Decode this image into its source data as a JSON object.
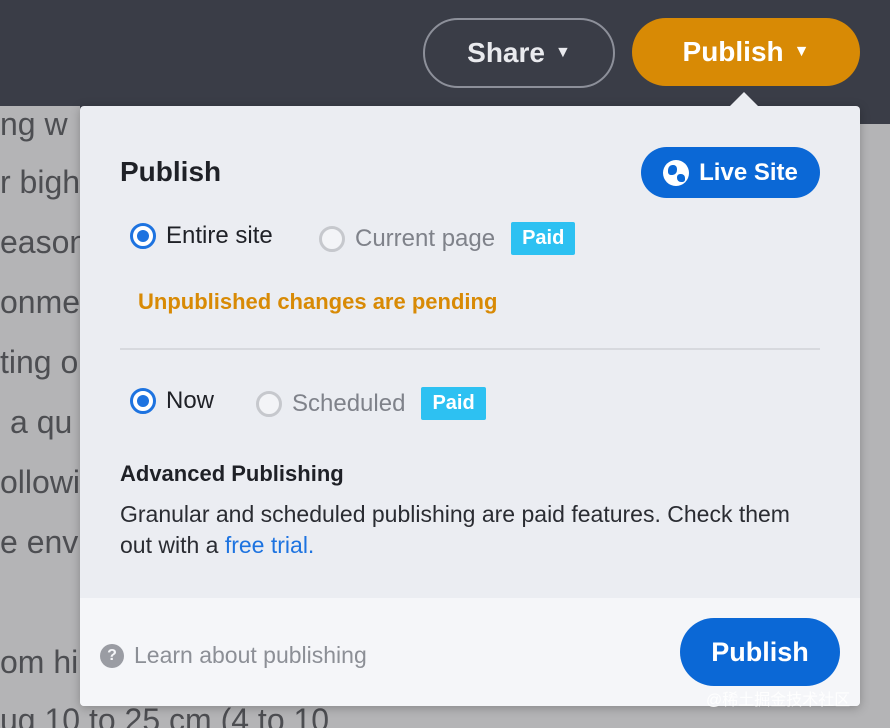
{
  "header": {
    "share_label": "Share",
    "publish_label": "Publish"
  },
  "background_text": {
    "lines": [
      "ng w",
      "r bigh",
      "eason",
      "onme",
      "ting o",
      "a qu",
      "ollowi",
      "e envi",
      "",
      "om hi"
    ],
    "bottom_line": "ug 10 to 25 cm (4 to 10"
  },
  "popup": {
    "title": "Publish",
    "live_site_label": "Live Site",
    "scope": {
      "options": [
        {
          "label": "Entire site",
          "selected": true
        },
        {
          "label": "Current page",
          "selected": false,
          "badge": "Paid"
        }
      ]
    },
    "pending_text": "Unpublished changes are pending",
    "timing": {
      "options": [
        {
          "label": "Now",
          "selected": true
        },
        {
          "label": "Scheduled",
          "selected": false,
          "badge": "Paid"
        }
      ]
    },
    "advanced": {
      "title": "Advanced Publishing",
      "text": "Granular and scheduled publishing are paid features. Check them out with a ",
      "link_text": "free trial."
    },
    "footer": {
      "help_label": "Learn about publishing",
      "help_icon": "?",
      "publish_label": "Publish"
    }
  },
  "watermark": "@稀土掘金技术社区",
  "colors": {
    "topbar": "#3a3d47",
    "orange": "#d88a05",
    "blue": "#0b68d6",
    "badge": "#2dc1f2"
  }
}
